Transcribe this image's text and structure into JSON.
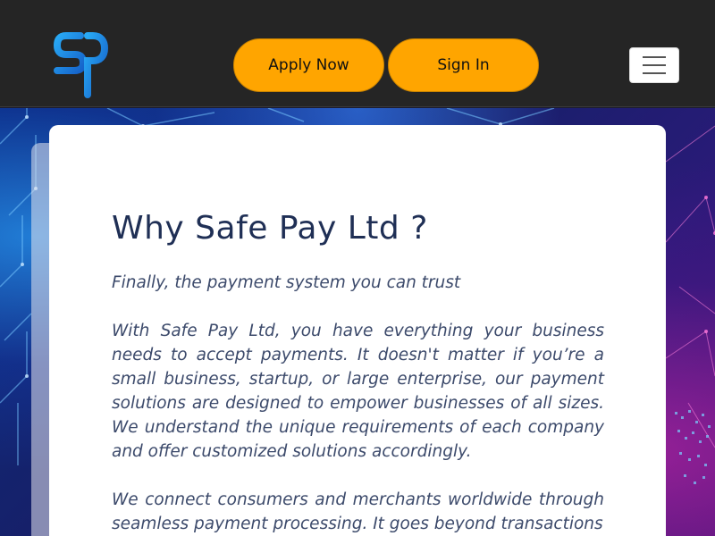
{
  "brand": {
    "logo": "safe-pay-logo",
    "accent": "#1e8fe6"
  },
  "header": {
    "apply_label": "Apply Now",
    "signin_label": "Sign In",
    "button_color": "#ffa500",
    "menu_icon": "hamburger-icon"
  },
  "main": {
    "title": "Why Safe Pay Ltd ?",
    "tagline": "Finally, the payment system you can trust",
    "paragraph1": "With Safe Pay Ltd, you have everything your business needs to accept payments. It doesn't matter if you’re a small business, startup, or large enterprise, our payment solutions are designed to empower businesses of all sizes.  We understand the unique requirements of each company and offer customized solutions accordingly.",
    "paragraph2": "We connect consumers and merchants worldwide through seamless payment processing. It goes beyond transactions"
  }
}
